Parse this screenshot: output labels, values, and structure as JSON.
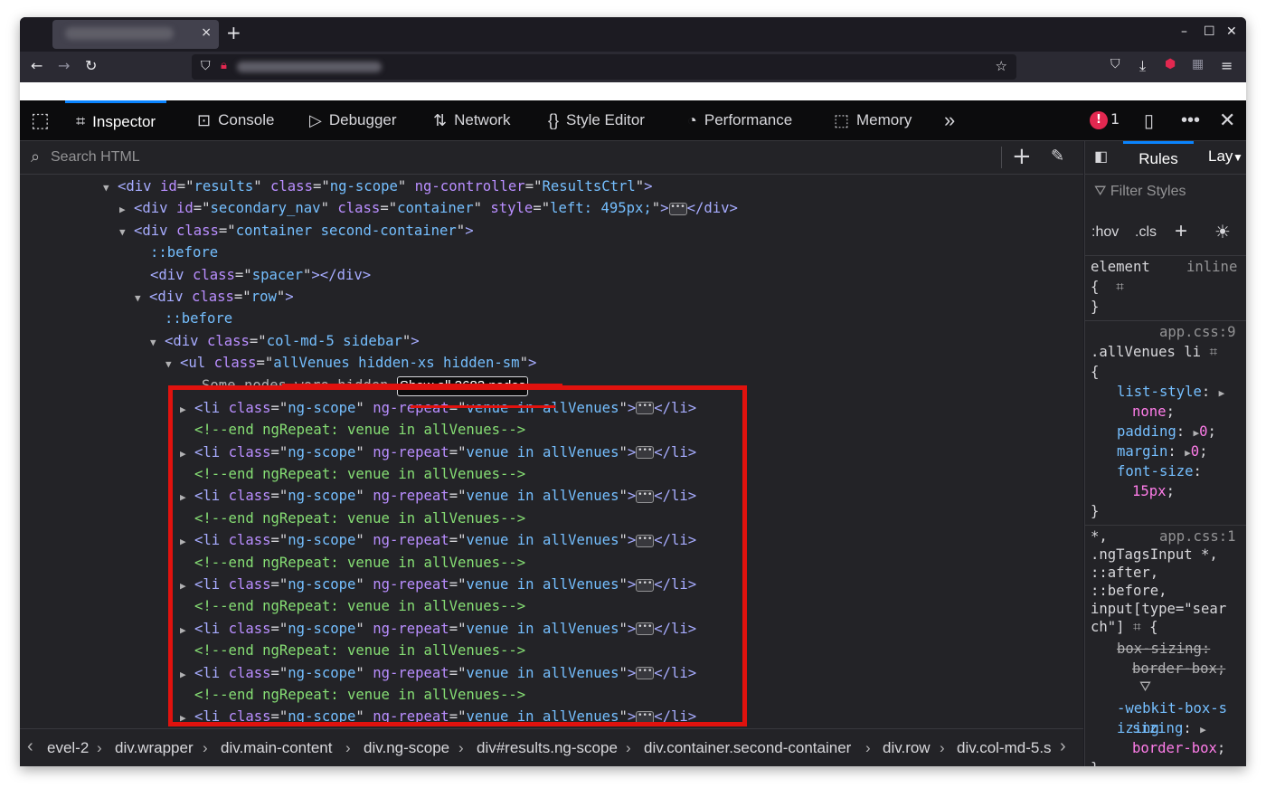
{
  "browser": {
    "tab_close": "×",
    "new_tab": "+",
    "window_controls": [
      "–",
      "☐",
      "✕"
    ]
  },
  "devtools": {
    "tools": [
      {
        "label": "Inspector",
        "icon": "inspector-icon"
      },
      {
        "label": "Console",
        "icon": "console-icon"
      },
      {
        "label": "Debugger",
        "icon": "debugger-icon"
      },
      {
        "label": "Network",
        "icon": "network-icon"
      },
      {
        "label": "Style Editor",
        "icon": "style-editor-icon"
      },
      {
        "label": "Performance",
        "icon": "performance-icon"
      },
      {
        "label": "Memory",
        "icon": "memory-icon"
      }
    ],
    "error_count": "1",
    "accent": "#0a84ff"
  },
  "inspector": {
    "search_placeholder": "Search HTML",
    "tree": [
      {
        "tag": "div",
        "attrs": [
          [
            "id",
            "results"
          ],
          [
            "class",
            "ng-scope"
          ],
          [
            "ng-controller",
            "ResultsCtrl"
          ]
        ],
        "end": ">"
      },
      {
        "tag": "div",
        "attrs": [
          [
            "id",
            "secondary_nav"
          ],
          [
            "class",
            "container"
          ],
          [
            "style",
            "left: 495px;"
          ]
        ],
        "end": "></div>"
      },
      {
        "tag": "div",
        "attrs": [
          [
            "class",
            "container second-container"
          ]
        ],
        "end": ">"
      },
      {
        "pseudo": "::before"
      },
      {
        "tag": "div",
        "attrs": [
          [
            "class",
            "spacer"
          ]
        ],
        "end": "></div>"
      },
      {
        "tag": "div",
        "attrs": [
          [
            "class",
            "row"
          ]
        ],
        "end": ">"
      },
      {
        "pseudo": "::before"
      },
      {
        "tag": "div",
        "attrs": [
          [
            "class",
            "col-md-5 sidebar"
          ]
        ],
        "end": ">"
      },
      {
        "tag": "ul",
        "attrs": [
          [
            "class",
            "allVenues hidden-xs hidden-sm"
          ]
        ],
        "end": ">"
      }
    ],
    "hidden_message": "Some nodes were hidden.",
    "show_all_button": "Show all 3683 nodes",
    "li_class": "ng-scope",
    "li_repeat": "venue in allVenues",
    "li_end": "></li>",
    "comment": "<!--end ngRepeat: venue in allVenues-->",
    "repeat_count": 8
  },
  "breadcrumbs": [
    "evel-2",
    "div.wrapper",
    "div.main-content",
    "div.ng-scope",
    "div#results.ng-scope",
    "div.container.second-container",
    "div.row",
    "div.col-md-5.s"
  ],
  "rules_pane": {
    "tabs": [
      "Rules",
      "Lay"
    ],
    "filter_placeholder": "Filter Styles",
    "hov": ":hov",
    "cls": ".cls",
    "element_rule": {
      "selector": "element",
      "source": "inline"
    },
    "rule1": {
      "source": "app.css:9",
      "selector": ".allVenues li",
      "declarations": [
        {
          "prop": "list-style",
          "value": "none"
        },
        {
          "prop": "padding",
          "value": "0"
        },
        {
          "prop": "margin",
          "value": "0"
        },
        {
          "prop": "font-size",
          "value": "15px"
        }
      ]
    },
    "rule2": {
      "source": "app.css:1",
      "selector_lines": [
        "*,",
        ".ngTagsInput *,",
        "::after,",
        "::before,",
        "input[type=\"sear",
        "ch\"]"
      ],
      "declarations": [
        {
          "prop": "box-sizing",
          "value": "border-box",
          "overridden": true
        },
        {
          "prop": "-webkit-box-sizing",
          "value": "border-box",
          "overridden": false
        }
      ]
    }
  }
}
